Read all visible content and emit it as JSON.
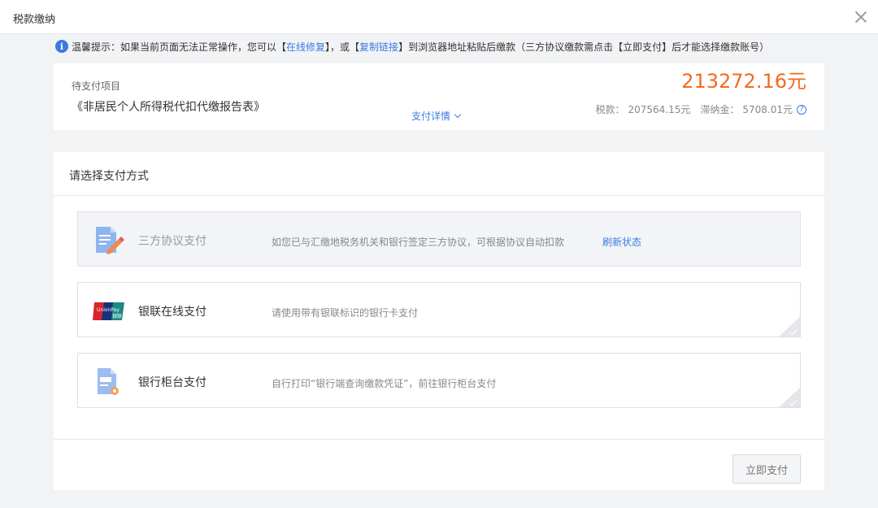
{
  "window": {
    "title": "税款缴纳"
  },
  "notice": {
    "prefix": "温馨提示：如果当前页面无法正常操作，您可以【",
    "repair_link": "在线修复",
    "middle": "】，或【",
    "copy_link": "复制链接",
    "suffix": "】到浏览器地址粘贴后缴款（三方协议缴款需点击【立即支付】后才能选择缴款账号）"
  },
  "summary": {
    "label": "待支付项目",
    "item": "《非居民个人所得税代扣代缴报告表》",
    "details_label": "支付详情",
    "amount": "213272.16元",
    "tax_label": "税款：",
    "tax_value": "207564.15元",
    "late_fee_label": "滞纳金：",
    "late_fee_value": "5708.01元"
  },
  "payment": {
    "title": "请选择支付方式",
    "options": [
      {
        "name": "三方协议支付",
        "desc": "如您已与汇缴地税务机关和银行签定三方协议，可根据协议自动扣款",
        "action": "刷新状态"
      },
      {
        "name": "银联在线支付",
        "desc": "请使用带有银联标识的银行卡支付"
      },
      {
        "name": "银行柜台支付",
        "desc": "自行打印“银行端查询缴款凭证”，前往银行柜台支付"
      }
    ],
    "submit_label": "立即支付"
  },
  "icons": {
    "info": "i",
    "help": "?",
    "unionpay_text": "UnionPay",
    "unionpay_cn": "银联"
  }
}
